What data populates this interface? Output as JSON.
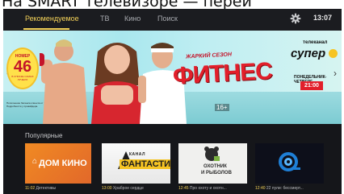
{
  "caption_text": "На SMART телевизоре — переи",
  "nav": {
    "tabs": [
      {
        "label": "Рекомендуемое",
        "active": true
      },
      {
        "label": "ТВ",
        "active": false
      },
      {
        "label": "Кино",
        "active": false
      },
      {
        "label": "Поиск",
        "active": false
      }
    ],
    "settings_icon": "gear-icon",
    "clock": "13:07"
  },
  "banner": {
    "badge_top": "НОМЕР",
    "badge_number": "46",
    "badge_bottom": "В СПИСКЕ САМЫХ ЛУЧШИХ",
    "fine_print": "Пополнение баланса клиента от телевизора. Подробности у провайдера.",
    "season_label": "ЖАРКИЙ СЕЗОН",
    "show_title": "ФИТНЕС",
    "age_rating": "16+",
    "channel_label": "телеканал",
    "channel_name": "супер",
    "schedule_days": "ПОНЕДЕЛЬНИК-ЧЕТВЕРГ",
    "schedule_time": "21:00",
    "prev_icon": "chevron-left-icon",
    "next_icon": "chevron-right-icon"
  },
  "popular": {
    "title": "Популярные",
    "items": [
      {
        "logo_text": "ДОМ КИНО",
        "time": "11:02",
        "name": "Детективы"
      },
      {
        "logo_top": "КАНАЛ",
        "logo_main": "ФАНТАСТИКА",
        "time": "13:00",
        "name": "Храброе сердце"
      },
      {
        "logo_line1": "ОХОТНИК",
        "logo_line2": "И РЫБОЛОВ",
        "time": "12:45",
        "name": "Про охоту и охотн..."
      },
      {
        "logo_icon": "snail-icon",
        "time": "12:40",
        "name": "22 пули: бессмерт..."
      }
    ]
  },
  "colors": {
    "accent": "#f3d158",
    "background": "#15161a",
    "title_red": "#e21f2b"
  }
}
